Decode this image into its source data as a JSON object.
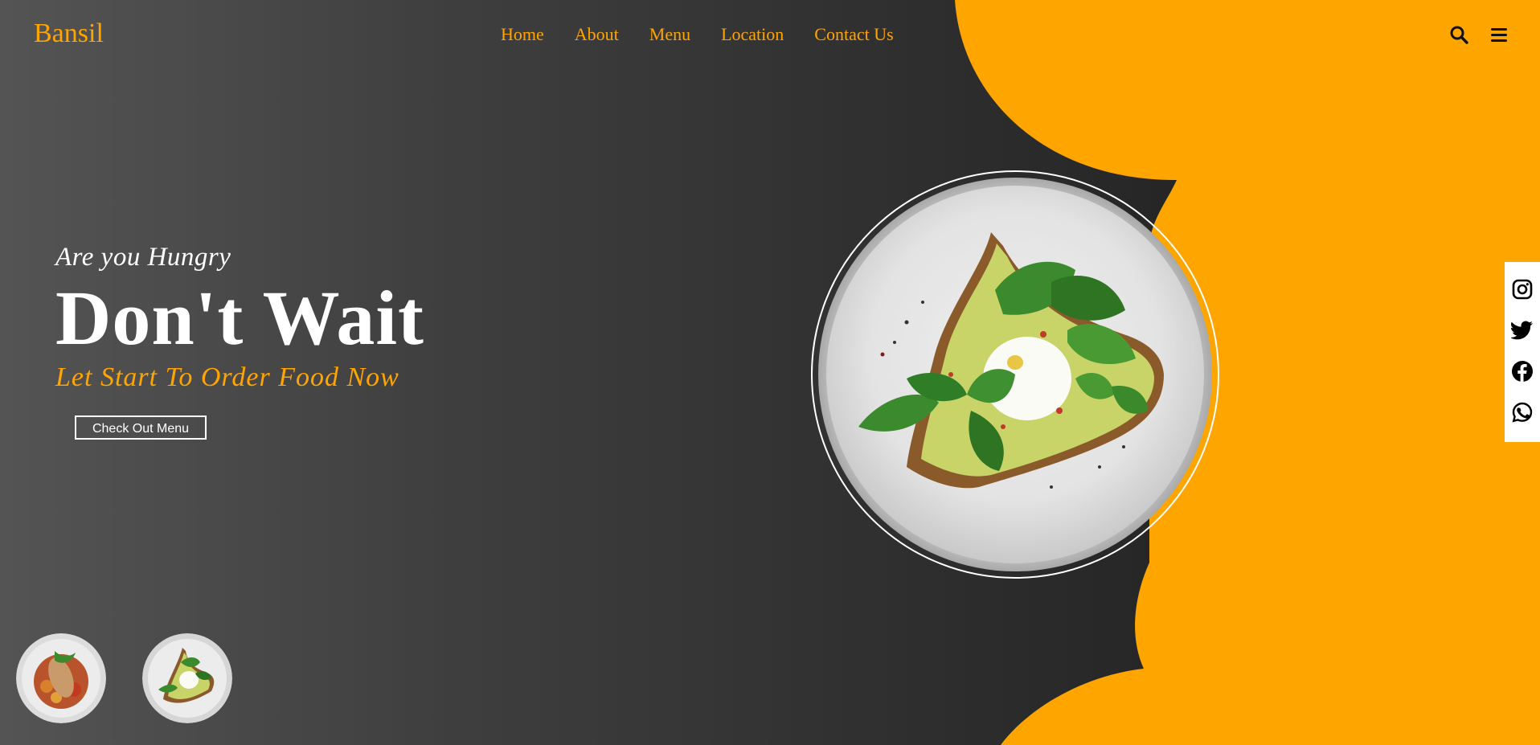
{
  "brand": {
    "name": "Bansil",
    "accent_color": "#ffa500",
    "dark_color": "#1b1b1b"
  },
  "nav": {
    "links": [
      "Home",
      "About",
      "Menu",
      "Location",
      "Contact Us"
    ],
    "icons": [
      "search-icon",
      "menu-icon"
    ]
  },
  "hero": {
    "subtitle": "Are you Hungry",
    "headline": "Don't Wait",
    "tagline": "Let Start To Order Food Now",
    "cta_label": "Check Out Menu",
    "main_image": "avocado-toast-plate"
  },
  "thumbnails": [
    {
      "image": "chicken-vegetable-plate"
    },
    {
      "image": "avocado-toast-plate"
    }
  ],
  "social": {
    "icons": [
      "instagram-icon",
      "twitter-icon",
      "facebook-icon",
      "whatsapp-icon"
    ]
  }
}
